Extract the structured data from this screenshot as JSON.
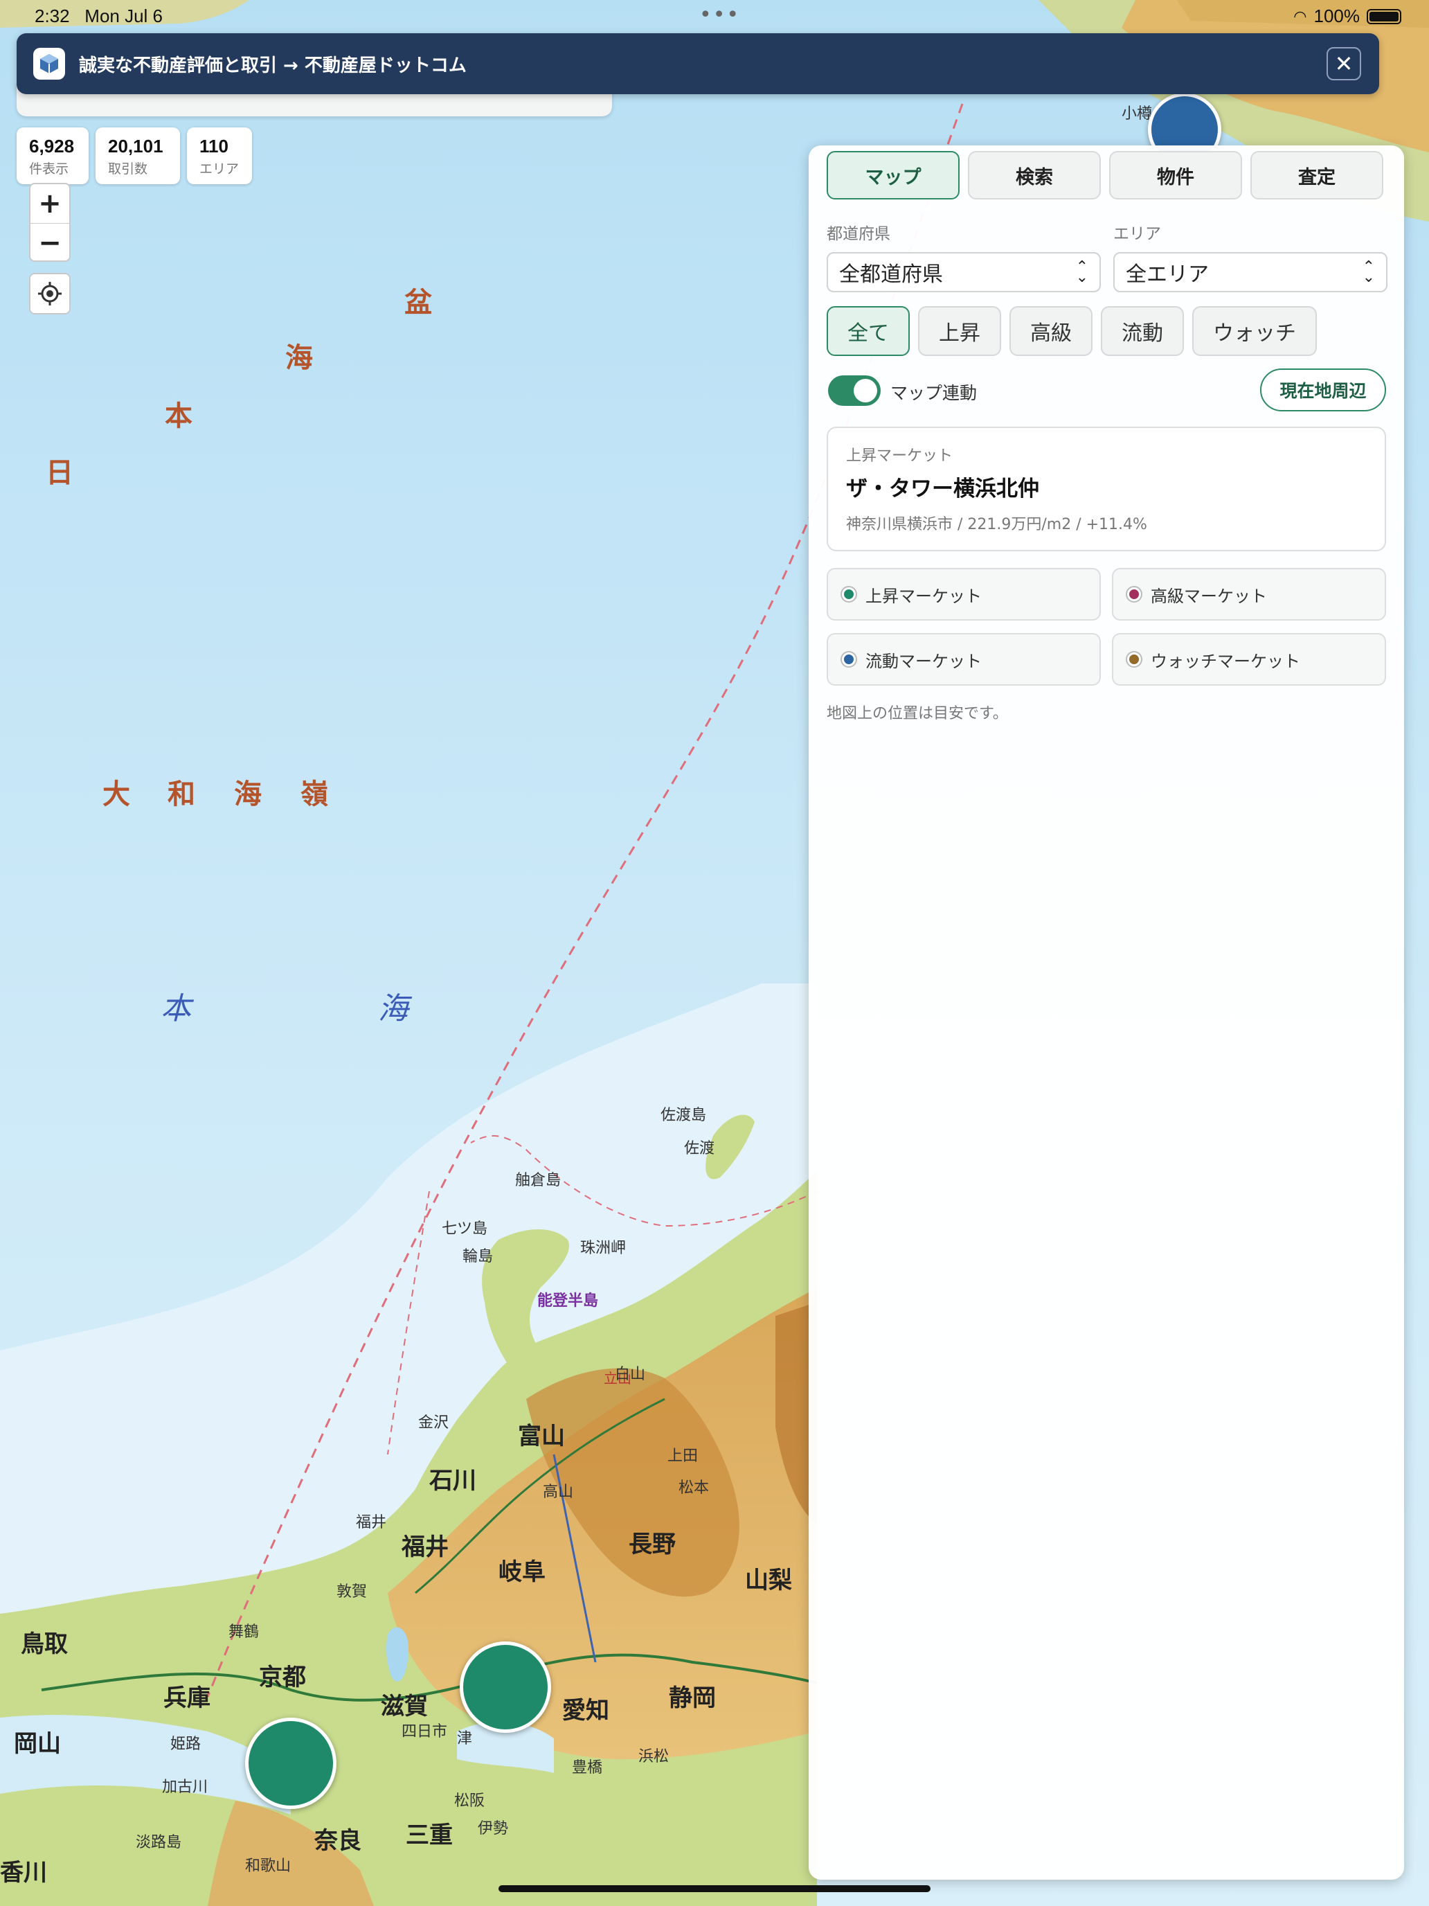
{
  "status_bar": {
    "time": "2:32",
    "date": "Mon Jul 6",
    "battery": "100%"
  },
  "banner": {
    "text": "誠実な不動産評価と取引 → 不動産屋ドットコム",
    "close_icon": "close-icon"
  },
  "stats": [
    {
      "value": "6,928",
      "label": "件表示"
    },
    {
      "value": "20,101",
      "label": "取引数"
    },
    {
      "value": "110",
      "label": "エリア"
    }
  ],
  "zoom": {
    "in": "+",
    "out": "−"
  },
  "map": {
    "sea_labels": [
      "日",
      "本",
      "海",
      "盆",
      "大",
      "和",
      "海",
      "嶺",
      "本",
      "海"
    ],
    "places": {
      "sado_island": "佐渡島",
      "sado": "佐渡",
      "awakura": "舳倉島",
      "nanatsu": "七ツ島",
      "wajima": "輪島",
      "noto": "能登半島",
      "suzu": "珠洲岬",
      "kanazawa": "金沢",
      "toyama_city": "富山",
      "toyama": "富山",
      "ishikawa": "石川",
      "fukui": "福井",
      "fukui_city": "福井",
      "gifu": "岐阜",
      "nagano": "長野",
      "yamanashi": "山梨",
      "shizuoka": "静岡",
      "aichi": "愛知",
      "shiga": "滋賀",
      "kyoto": "京都",
      "hyogo": "兵庫",
      "nara": "奈良",
      "mie": "三重",
      "okayama": "岡山",
      "tottori": "鳥取",
      "kagawa": "香川",
      "wakayama": "和歌山",
      "tsuruga": "敦賀",
      "tsu": "津",
      "matsusaka": "松阪",
      "ise": "伊勢",
      "hamamatsu": "浜松",
      "toyohashi": "豊橋",
      "ichinomiya": "四日市",
      "kakogawa": "加古川",
      "himeji": "姫路",
      "maizuru": "舞鶴",
      "otaru": "小樽",
      "uwajima": "淡路島",
      "tateyama": "立山",
      "hakusan": "白山",
      "takayama": "高山",
      "matsumoto": "松本",
      "ueda": "上田"
    },
    "markers": [
      {
        "type": "rising",
        "color": "#1f8a6a"
      },
      {
        "type": "rising",
        "color": "#1f8a6a"
      },
      {
        "type": "fluid",
        "color": "#2b66a3"
      }
    ]
  },
  "panel": {
    "tabs": [
      "マップ",
      "検索",
      "物件",
      "査定"
    ],
    "active_tab": "マップ",
    "prefecture_label": "都道府県",
    "prefecture_value": "全都道府県",
    "area_label": "エリア",
    "area_value": "全エリア",
    "chips": [
      "全て",
      "上昇",
      "高級",
      "流動",
      "ウォッチ"
    ],
    "active_chip": "全て",
    "toggle_label": "マップ連動",
    "toggle_on": true,
    "nearby_button": "現在地周辺",
    "featured": {
      "kind": "上昇マーケット",
      "title": "ザ・タワー横浜北仲",
      "meta": "神奈川県横浜市 / 221.9万円/m2 / +11.4%"
    },
    "legend": [
      {
        "label": "上昇マーケット",
        "color": "#1f8a6a"
      },
      {
        "label": "高級マーケット",
        "color": "#a3305c"
      },
      {
        "label": "流動マーケット",
        "color": "#2b66a3"
      },
      {
        "label": "ウォッチマーケット",
        "color": "#946a2a"
      }
    ],
    "note": "地図上の位置は目安です。"
  }
}
